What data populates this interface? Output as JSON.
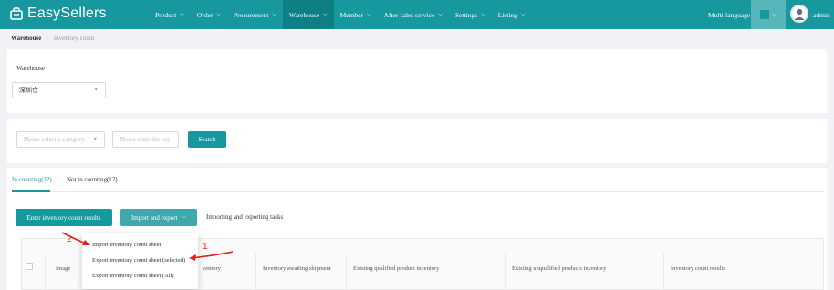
{
  "app": {
    "logo_text": "EasySellers"
  },
  "nav": {
    "items": [
      {
        "label": "Product"
      },
      {
        "label": "Order"
      },
      {
        "label": "Procurement"
      },
      {
        "label": "Warehouse"
      },
      {
        "label": "Member"
      },
      {
        "label": "After-sales service"
      },
      {
        "label": "Settings"
      },
      {
        "label": "Listing"
      }
    ],
    "multi_language": "Multi-language",
    "user": "admin"
  },
  "breadcrumb": {
    "first": "Warehouse",
    "current": "Inventory count"
  },
  "filters": {
    "warehouse_label": "Warehouse",
    "warehouse_value": "深圳仓",
    "category_placeholder": "Please select a category.",
    "keyword_placeholder": "Please enter the key",
    "search_label": "Search"
  },
  "tabs": [
    {
      "label": "In counting(22)"
    },
    {
      "label": "Not in counting(12)"
    }
  ],
  "actions": {
    "enter_results": "Enter inventory count results",
    "import_export": "Import and export",
    "tasks_link": "Importing and exporting tasks"
  },
  "dropdown": {
    "items": [
      "Import inventory count sheet",
      "Export inventory count sheet (selected)",
      "Export inventory count sheet (All)"
    ]
  },
  "table": {
    "headers": [
      "Image",
      "ventory",
      "Inventory awaiting shipment",
      "Existing qualified product inventory",
      "Existing unqualified products inventory",
      "Inventory count results"
    ]
  },
  "annotations": {
    "one": "1",
    "two": "2"
  },
  "colors": {
    "brand": "#17979e",
    "annotation": "#e02020"
  }
}
